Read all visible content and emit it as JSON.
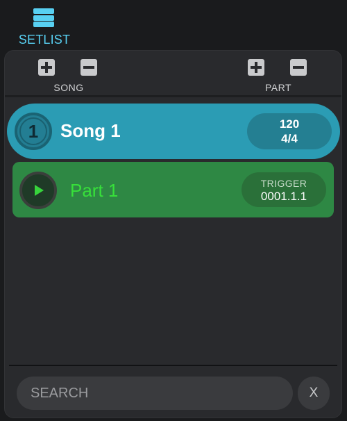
{
  "header": {
    "tab_label": "SETLIST",
    "tab_icon": "hamburger-menu-icon",
    "accent_color": "#58d0f2"
  },
  "controls": {
    "song": {
      "label": "SONG",
      "add_icon": "plus-icon",
      "remove_icon": "minus-icon"
    },
    "part": {
      "label": "PART",
      "add_icon": "plus-icon",
      "remove_icon": "minus-icon"
    }
  },
  "song": {
    "number": "1",
    "title": "Song 1",
    "tempo": "120",
    "time_signature": "4/4",
    "color": "#2b9cb4"
  },
  "part": {
    "title": "Part 1",
    "trigger_label": "TRIGGER",
    "trigger_value": "0001.1.1",
    "play_icon": "play-icon",
    "color": "#2e8844",
    "title_color": "#37e03a"
  },
  "search": {
    "placeholder": "SEARCH",
    "clear_label": "X"
  }
}
